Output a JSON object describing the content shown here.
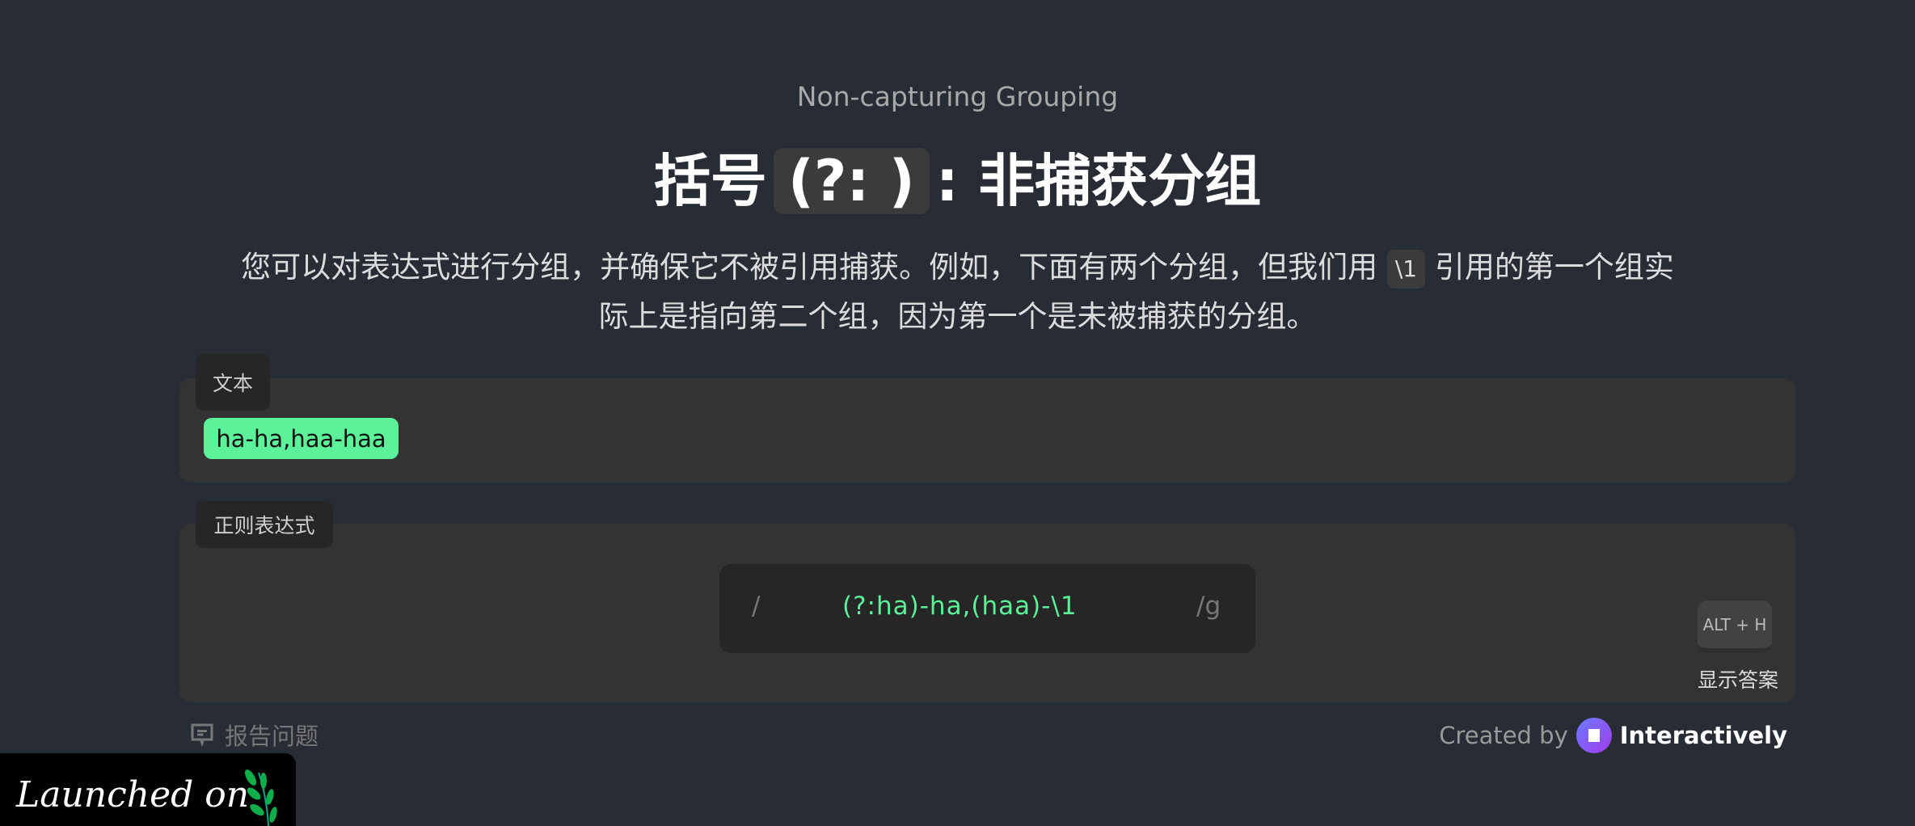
{
  "header": {
    "subtitle": "Non-capturing Grouping",
    "title_pre": "括号",
    "title_code": "(?: )",
    "title_post": ": 非捕获分组"
  },
  "description": {
    "part1": "您可以对表达式进行分组，并确保它不被引用捕获。例如，下面有两个分组，但我们用",
    "code": "\\1",
    "part2": "引用的第一个组实",
    "line2": "际上是指向第二个组，因为第一个是未被捕获的分组。"
  },
  "text_panel": {
    "label": "文本",
    "match": "ha-ha,haa-haa"
  },
  "regex_panel": {
    "label": "正则表达式",
    "open": "/",
    "value": "(?:ha)-ha,(haa)-\\1",
    "flags": "/g",
    "shortcut": "ALT + H",
    "show_answer": "显示答案"
  },
  "footer": {
    "report": "报告问题",
    "created_by": "Created by",
    "brand": "Interactively",
    "badge": "Launched on"
  },
  "colors": {
    "background": "#282c34",
    "panel": "#333333",
    "match": "#5cf29a",
    "regex_text": "#5cf29a"
  }
}
